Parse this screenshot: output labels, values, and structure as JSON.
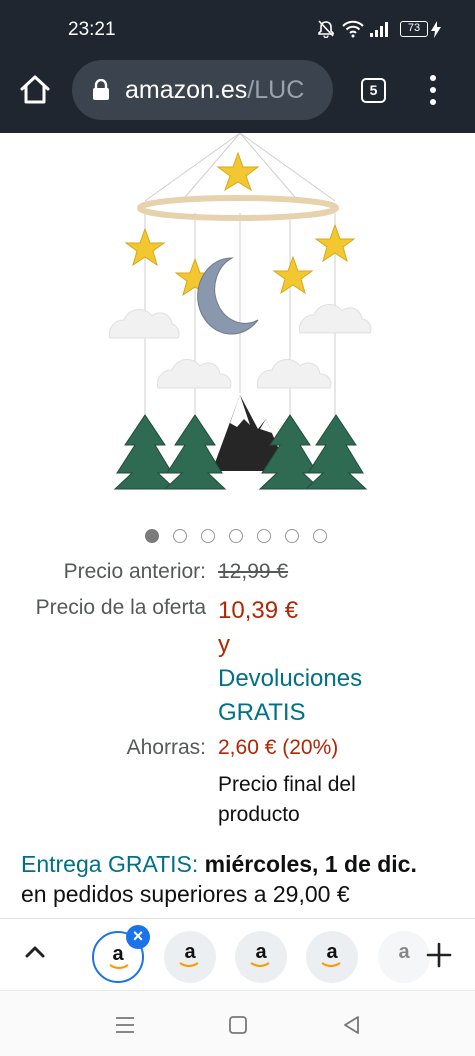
{
  "status_bar": {
    "time": "23:21",
    "battery": "73"
  },
  "browser": {
    "url_domain": "amazon.es",
    "url_path": "/LUC",
    "tab_count": "5"
  },
  "product": {
    "image_icon": "baby-mobile-image",
    "carousel": {
      "count": 7,
      "active": 0
    },
    "labels": {
      "previous": "Precio anterior:",
      "deal": "Precio de la oferta",
      "savings": "Ahorras:"
    },
    "previous_price": "12,99 €",
    "deal_price": "10,39 €",
    "and": "y",
    "returns_1": "Devoluciones",
    "returns_2": "GRATIS",
    "savings": "2,60 € (20%)",
    "final_1": "Precio final del",
    "final_2": "producto"
  },
  "delivery": {
    "free_label": "Entrega GRATIS:",
    "date": "miércoles, 1 de dic.",
    "condition": "en pedidos superiores a 29,00 €"
  },
  "tab_strip": {
    "tab_letter": "a",
    "close_icon": "×"
  },
  "colors": {
    "price_red": "#b12704",
    "link_teal": "#007185",
    "chrome_dark": "#1f2630",
    "accent_blue": "#1a73e8"
  }
}
